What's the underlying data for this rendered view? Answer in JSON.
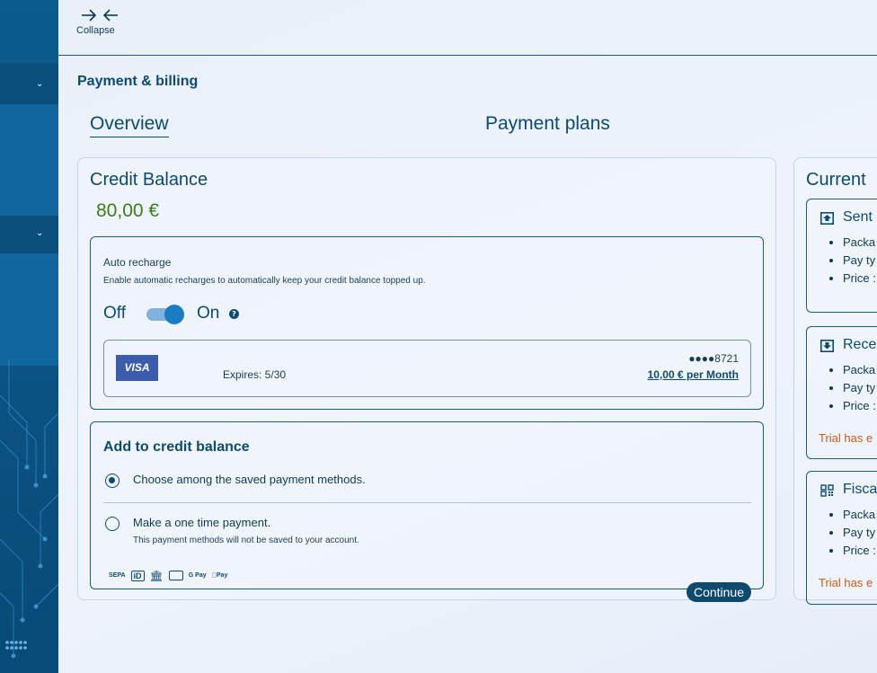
{
  "toolbar": {
    "collapse_label": "Collapse"
  },
  "page": {
    "title": "Payment & billing"
  },
  "tabs": [
    {
      "label": "Overview",
      "active": true
    },
    {
      "label": "Payment plans",
      "active": false
    }
  ],
  "credit": {
    "title": "Credit Balance",
    "amount": "80,00 €",
    "amount_color": "#3a7d1e"
  },
  "auto_recharge": {
    "label": "Auto recharge",
    "description": "Enable automatic recharges to automatically keep your credit balance topped up.",
    "off_label": "Off",
    "on_label": "On",
    "enabled": true,
    "help": "?",
    "card": {
      "brand": "VISA",
      "expires": "Expires: 5/30",
      "masked_number": "●●●●8721",
      "plan": "10,00 € per Month"
    }
  },
  "add_credit": {
    "title": "Add to credit balance",
    "options": [
      {
        "label": "Choose among the saved payment methods.",
        "checked": true
      },
      {
        "label": "Make a one time payment.",
        "checked": false,
        "description": "This payment methods will not be saved to your account."
      }
    ],
    "payment_methods": [
      "SEPA",
      "iD",
      "bank",
      "card",
      "G Pay",
      "Pay"
    ],
    "continue_label": "Continue"
  },
  "current": {
    "title": "Current",
    "services": [
      {
        "name": "Sent",
        "icon": "inbox-up-icon",
        "items": [
          "Packa",
          "Pay ty",
          "Price :"
        ],
        "trial": ""
      },
      {
        "name": "Rece",
        "icon": "inbox-down-icon",
        "items": [
          "Packa",
          "Pay ty",
          "Price :"
        ],
        "trial": "Trial has e"
      },
      {
        "name": "Fisca",
        "icon": "qr-icon",
        "items": [
          "Packa",
          "Pay ty",
          "Price :"
        ],
        "trial": "Trial has e"
      }
    ]
  },
  "colors": {
    "accent": "#0d4a6e",
    "sidebar": "#0b5b8d",
    "toggle": "#1a7dc4",
    "trial": "#c85a1a"
  }
}
